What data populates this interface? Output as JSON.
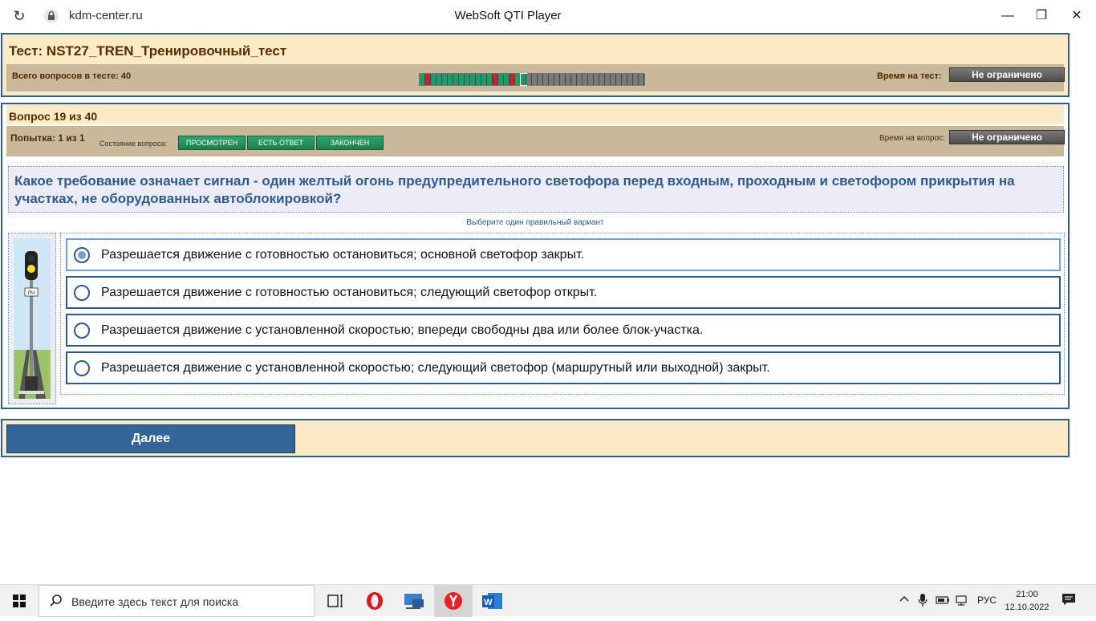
{
  "browser": {
    "url": "kdm-center.ru",
    "window_title": "WebSoft QTI Player"
  },
  "test": {
    "title": "Тест: NST27_TREN_Тренировочный_тест",
    "total_label": "Всего вопросов в тесте: 40",
    "time_label": "Время на тест:",
    "time_value": "Не ограничено",
    "progress": {
      "count": 40,
      "current": 19,
      "green": [
        1,
        3,
        4,
        5,
        6,
        7,
        8,
        9,
        10,
        11,
        12,
        13,
        15,
        16,
        18,
        19
      ],
      "red": [
        2,
        14,
        17
      ]
    }
  },
  "question": {
    "number_label": "Вопрос 19 из 40",
    "attempt_label": "Попытка: 1 из 1",
    "state_label": "Состояние вопроса:",
    "states": [
      "ПРОСМОТРЕН",
      "ЕСТЬ ОТВЕТ",
      "ЗАКОНЧЕН"
    ],
    "time_label": "Время на вопрос:",
    "time_value": "Не ограничено",
    "text": "Какое требование означает сигнал - один желтый огонь предупредительного светофора перед входным, проходным и светофором прикрытия на участках, не оборудованных автоблокировкой?",
    "hint": "Выберите один правильный вариант",
    "sign_label": "ПЧ",
    "answers": [
      {
        "text": "Разрешается движение с готовностью остановиться; основной светофор закрыт.",
        "selected": true
      },
      {
        "text": "Разрешается движение с готовностью остановиться; следующий светофор открыт.",
        "selected": false
      },
      {
        "text": "Разрешается движение с установленной скоростью; впереди свободны два или более блок-участка.",
        "selected": false
      },
      {
        "text": "Разрешается движение с установленной скоростью; следующий светофор (маршрутный или выходной) закрыт.",
        "selected": false
      }
    ]
  },
  "footer": {
    "next_label": "Далее"
  },
  "taskbar": {
    "search_placeholder": "Введите здесь текст для поиска",
    "lang": "РУС",
    "time": "21:00",
    "date": "12.10.2022"
  }
}
